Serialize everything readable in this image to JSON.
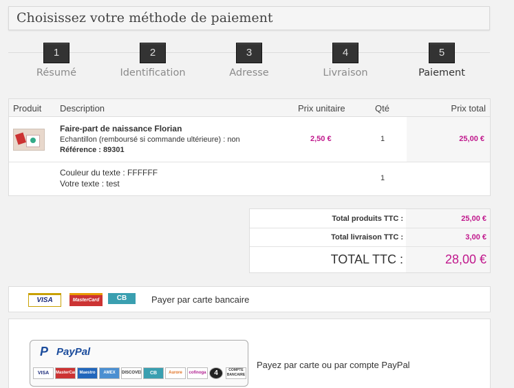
{
  "page": {
    "title": "Choisissez votre méthode de paiement"
  },
  "steps": [
    {
      "num": "1",
      "label": "Résumé"
    },
    {
      "num": "2",
      "label": "Identification"
    },
    {
      "num": "3",
      "label": "Adresse"
    },
    {
      "num": "4",
      "label": "Livraison"
    },
    {
      "num": "5",
      "label": "Paiement"
    }
  ],
  "cart": {
    "headers": {
      "product": "Produit",
      "description": "Description",
      "unit_price": "Prix unitaire",
      "qty": "Qté",
      "total": "Prix total"
    },
    "items": [
      {
        "name": "Faire-part de naissance Florian",
        "detail": "Echantillon (remboursé si commande ultérieure) : non",
        "reference": "Référence : 89301",
        "unit_price": "2,50 €",
        "qty": "1",
        "total": "25,00 €"
      }
    ],
    "customization": {
      "color": "Couleur du texte : FFFFFF",
      "text": "Votre texte : test",
      "qty": "1"
    }
  },
  "totals": {
    "products_label": "Total produits TTC :",
    "products_value": "25,00 €",
    "shipping_label": "Total livraison TTC :",
    "shipping_value": "3,00 €",
    "grand_label": "TOTAL TTC :",
    "grand_value": "28,00 €"
  },
  "payment": {
    "card_label": "Payer par carte bancaire",
    "card_logos": [
      "VISA",
      "MasterCard",
      "CB"
    ],
    "paypal_label": "Payez par carte ou par compte PayPal",
    "paypal_brand": "PayPal",
    "paypal_logos": [
      "VISA",
      "MasterCard",
      "Maestro",
      "AMEX",
      "DISCOVER",
      "CB",
      "Aurore",
      "cofinoga",
      "4",
      "COMPTE BANCAIRE"
    ]
  },
  "colors": {
    "accent": "#c0178c",
    "step_box": "#333333"
  }
}
